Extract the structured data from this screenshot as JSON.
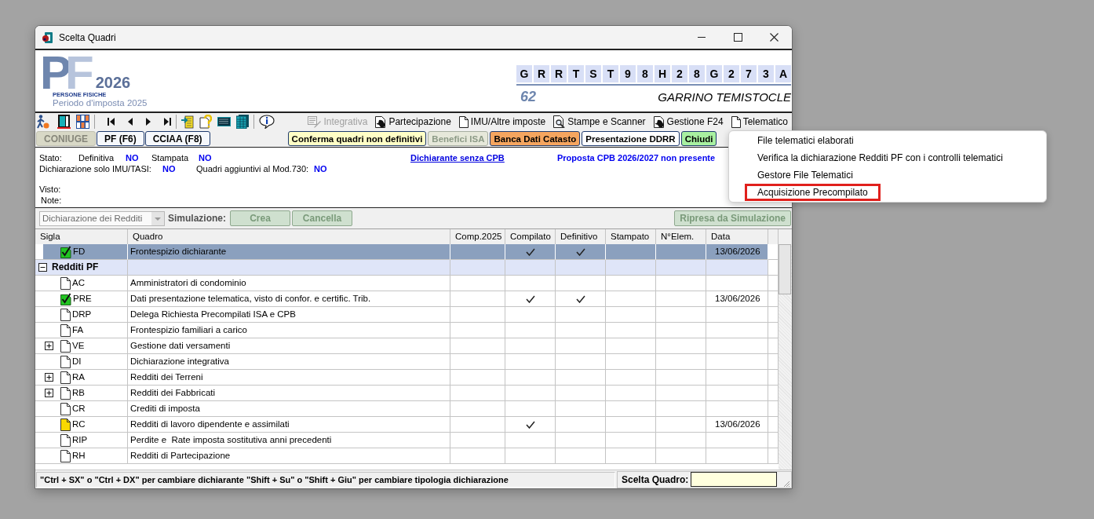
{
  "window": {
    "title": "Scelta Quadri"
  },
  "header": {
    "logo": {
      "monogram": "PF",
      "year": "2026",
      "subtitle": "PERSONE FISICHE",
      "period": "Periodo d'imposta 2025"
    },
    "fiscal_code": [
      "G",
      "R",
      "R",
      "T",
      "S",
      "T",
      "9",
      "8",
      "H",
      "2",
      "8",
      "G",
      "2",
      "7",
      "3",
      "A"
    ],
    "number": "62",
    "name": "GARRINO TEMISTOCLE"
  },
  "toolbar": {
    "buttons": [
      {
        "label": "Integrativa",
        "disabled": true
      },
      {
        "label": "Partecipazione",
        "disabled": false
      },
      {
        "label": "IMU/Altre imposte",
        "disabled": false
      },
      {
        "label": "Stampe e Scanner",
        "disabled": false
      },
      {
        "label": "Gestione F24",
        "disabled": false
      },
      {
        "label": "Telematico",
        "disabled": false
      }
    ]
  },
  "declarant_tabs": [
    {
      "label": "CONIUGE",
      "disabled": true
    },
    {
      "label": "PF (F6)",
      "disabled": false
    },
    {
      "label": "CCIAA (F8)",
      "disabled": false
    }
  ],
  "actions": [
    {
      "label": "Conferma quadri non definitivi",
      "color": "#ffffc6",
      "disabled": false
    },
    {
      "label": "Benefici ISA",
      "color": "#e6e8da",
      "disabled": true
    },
    {
      "label": "Banca Dati Catasto",
      "color": "#f5a55f",
      "disabled": false
    },
    {
      "label": "Presentazione DDRR",
      "color": "#ffffff",
      "disabled": false
    },
    {
      "label": "Chiudi",
      "color": "#a8f0a0",
      "disabled": false
    }
  ],
  "info": {
    "stato_label": "Stato:",
    "flags": [
      {
        "label": "Definitiva",
        "value": "NO"
      },
      {
        "label": "Stampata",
        "value": "NO"
      }
    ],
    "cpb_link": "Dichiarante senza CPB",
    "cpb_note": "Proposta CPB 2026/2027 non presente",
    "extras": [
      {
        "label": "Dichiarazione solo IMU/TASI:",
        "value": "NO"
      },
      {
        "label": "Quadri aggiuntivi al Mod.730:",
        "value": "NO"
      }
    ],
    "visto_label": "Visto:",
    "note_label": "Note:"
  },
  "simulation": {
    "declaration_type": {
      "value": "Dichiarazione dei Redditi",
      "disabled": true
    },
    "label": "Simulazione:",
    "buttons": [
      {
        "label": "Crea",
        "disabled": true
      },
      {
        "label": "Cancella",
        "disabled": true
      }
    ],
    "resume_button": {
      "label": "Ripresa da Simulazione",
      "disabled": true
    }
  },
  "table": {
    "columns": [
      "Sigla",
      "Quadro",
      "Comp.2025",
      "Compilato",
      "Definitivo",
      "Stampato",
      "N°Elem.",
      "Data"
    ],
    "rows": [
      {
        "kind": "complete",
        "sigla": "FD",
        "quadro": "Frontespizio dichiarante",
        "expandable": false,
        "compilato": true,
        "definitivo": true,
        "data": "13/06/2026",
        "selected": true
      },
      {
        "kind": "group",
        "label": "Redditi PF",
        "expanded": true,
        "selected": false,
        "children": [
          {
            "kind": "empty",
            "sigla": "AC",
            "quadro": "Amministratori di condominio",
            "expandable": false,
            "compilato": false,
            "definitivo": false,
            "selected": false
          },
          {
            "kind": "complete",
            "sigla": "PRE",
            "quadro": "Dati presentazione telematica, visto di confor. e certific. Trib.",
            "expandable": false,
            "compilato": true,
            "definitivo": true,
            "data": "13/06/2026",
            "selected": false
          },
          {
            "kind": "empty",
            "sigla": "DRP",
            "quadro": "Delega Richiesta Precompilati ISA e CPB",
            "expandable": false,
            "compilato": false,
            "definitivo": false,
            "selected": false
          },
          {
            "kind": "empty",
            "sigla": "FA",
            "quadro": "Frontespizio familiari a carico",
            "expandable": false,
            "compilato": false,
            "definitivo": false,
            "selected": false
          },
          {
            "kind": "empty",
            "sigla": "VE",
            "quadro": "Gestione dati versamenti",
            "expandable": true,
            "compilato": false,
            "definitivo": false,
            "selected": false
          },
          {
            "kind": "empty",
            "sigla": "DI",
            "quadro": "Dichiarazione integrativa",
            "expandable": false,
            "compilato": false,
            "definitivo": false,
            "selected": false
          },
          {
            "kind": "empty",
            "sigla": "RA",
            "quadro": "Redditi dei Terreni",
            "expandable": true,
            "compilato": false,
            "definitivo": false,
            "selected": false
          },
          {
            "kind": "empty",
            "sigla": "RB",
            "quadro": "Redditi dei Fabbricati",
            "expandable": true,
            "compilato": false,
            "definitivo": false,
            "selected": false
          },
          {
            "kind": "empty",
            "sigla": "CR",
            "quadro": "Crediti di imposta",
            "expandable": false,
            "compilato": false,
            "definitivo": false,
            "selected": false
          },
          {
            "kind": "partial",
            "sigla": "RC",
            "quadro": "Redditi di lavoro dipendente e assimilati",
            "expandable": false,
            "compilato": true,
            "definitivo": false,
            "data": "13/06/2026",
            "selected": false
          },
          {
            "kind": "empty",
            "sigla": "RIP",
            "quadro": "Perdite e  Rate imposta sostitutiva anni precedenti",
            "expandable": false,
            "compilato": false,
            "definitivo": false,
            "selected": false
          },
          {
            "kind": "empty",
            "sigla": "RH",
            "quadro": "Redditi di Partecipazione",
            "expandable": false,
            "compilato": false,
            "definitivo": false,
            "selected": false
          }
        ]
      }
    ]
  },
  "status_bar": {
    "hint": "\"Ctrl + SX\" o \"Ctrl + DX\" per cambiare dichiarante \"Shift + Su\" o \"Shift + Giu\" per cambiare tipologia dichiarazione",
    "field_label": "Scelta Quadro:"
  },
  "context_menu": {
    "items": [
      {
        "label": "File telematici elaborati",
        "highlighted": false
      },
      {
        "label": "Verifica la dichiarazione Redditi PF con i controlli telematici",
        "highlighted": false
      },
      {
        "label": "Gestore File Telematici",
        "highlighted": false
      },
      {
        "label": "Acquisizione Precompilato",
        "highlighted": true
      }
    ]
  }
}
